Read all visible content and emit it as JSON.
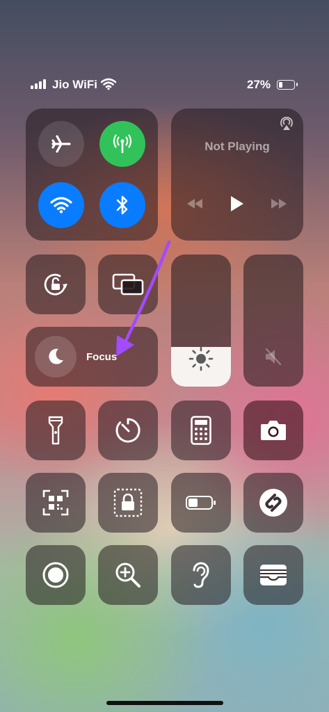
{
  "status_bar": {
    "carrier": "Jio WiFi",
    "battery_percent": "27%",
    "battery_level": 0.27
  },
  "connectivity": {
    "airplane_icon": "airplane-icon",
    "cellular_icon": "antenna-icon",
    "wifi_icon": "wifi-icon",
    "bluetooth_icon": "bluetooth-icon"
  },
  "now_playing": {
    "title": "Not Playing"
  },
  "focus": {
    "label": "Focus"
  },
  "sliders": {
    "brightness_level": 0.3,
    "volume_level": 0.0
  },
  "colors": {
    "green": "#32c25a",
    "blue": "#0a7cff",
    "tile": "#1e161a"
  }
}
